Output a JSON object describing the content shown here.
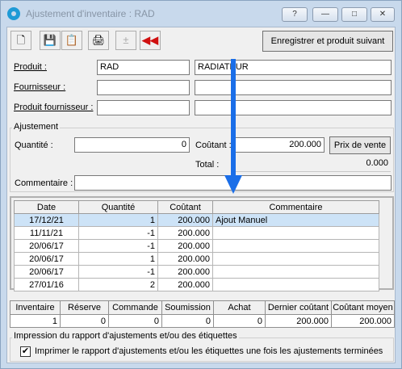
{
  "window": {
    "title": "Ajustement d'inventaire : RAD",
    "help_label": "?",
    "minimize_label": "—",
    "maximize_label": "□",
    "close_label": "✕"
  },
  "toolbar": {
    "save_and_next_label": "Enregistrer et produit suivant",
    "new_icon": "new-document-icon",
    "save_icon": "save-icon",
    "save_copy_icon": "save-copy-icon",
    "print_icon": "print-icon",
    "adjust_icon": "plus-minus-icon",
    "back_icon": "rewind-icon"
  },
  "product": {
    "produit_label": "Produit :",
    "produit_code": "RAD",
    "produit_desc": "RADIATEUR",
    "fournisseur_label": "Fournisseur :",
    "fournisseur_code": "",
    "fournisseur_desc": "",
    "produit_fournisseur_label": "Produit fournisseur :",
    "produit_fournisseur_code": "",
    "produit_fournisseur_desc": ""
  },
  "ajustement": {
    "group_label": "Ajustement",
    "quantite_label": "Quantité :",
    "quantite_value": "0",
    "coutant_label": "Coûtant :",
    "coutant_value": "200.000",
    "prix_vente_label": "Prix de vente",
    "total_label": "Total :",
    "total_value": "0.000",
    "commentaire_label": "Commentaire :",
    "commentaire_value": ""
  },
  "history": {
    "columns": [
      "Date",
      "Quantité",
      "Coûtant",
      "Commentaire"
    ],
    "rows": [
      [
        "17/12/21",
        "1",
        "200.000",
        "Ajout Manuel"
      ],
      [
        "11/11/21",
        "-1",
        "200.000",
        ""
      ],
      [
        "20/06/17",
        "-1",
        "200.000",
        ""
      ],
      [
        "20/06/17",
        "1",
        "200.000",
        ""
      ],
      [
        "20/06/17",
        "-1",
        "200.000",
        ""
      ],
      [
        "27/01/16",
        "2",
        "200.000",
        ""
      ]
    ]
  },
  "summary": {
    "columns": [
      "Inventaire",
      "Réserve",
      "Commande",
      "Soumission",
      "Achat",
      "Dernier coûtant",
      "Coûtant moyen"
    ],
    "values": [
      "1",
      "0",
      "0",
      "0",
      "0",
      "200.000",
      "200.000"
    ]
  },
  "print": {
    "group_label": "Impression du rapport d'ajustements et/ou des étiquettes",
    "checkbox_label": "Imprimer le rapport d'ajustements et/ou les étiquettes une fois les ajustements terminées",
    "checked": true,
    "check_mark": "✔"
  },
  "colors": {
    "accent_arrow": "#1a6ee8",
    "selected_row": "#cde3f7",
    "back_icon": "#d01010"
  }
}
